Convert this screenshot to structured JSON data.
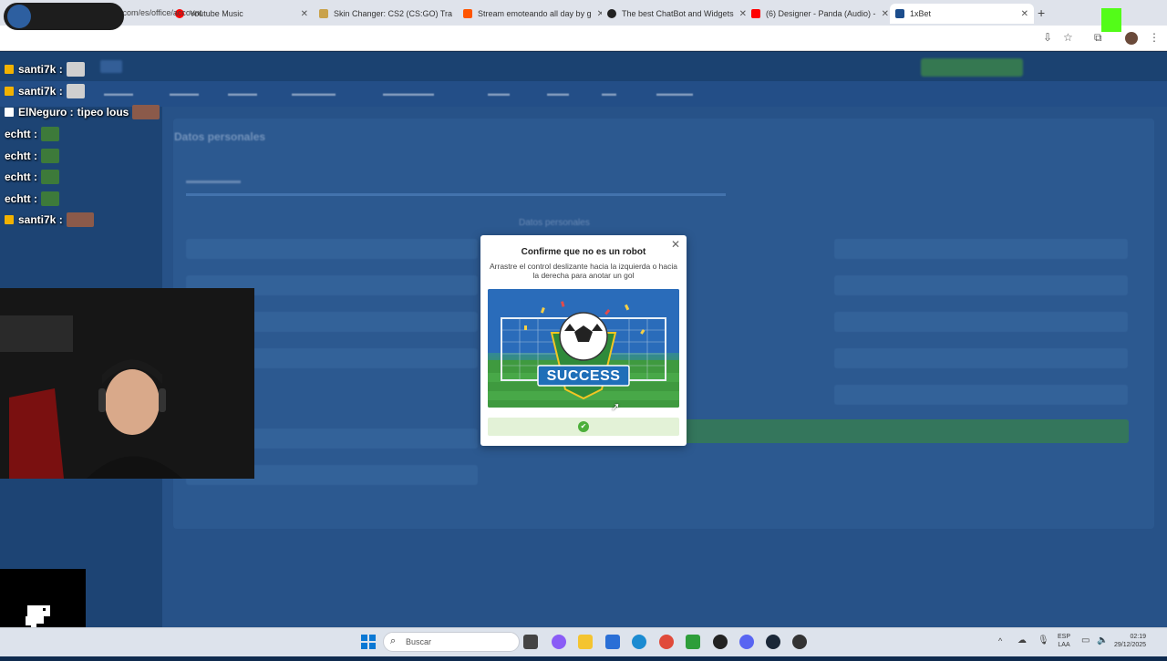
{
  "browser": {
    "tabs": [
      {
        "label": "Youtube Music",
        "icon": "youtube-music-icon"
      },
      {
        "label": "Skin Changer: CS2 (CS:GO) Tra",
        "icon": "skin-changer-icon"
      },
      {
        "label": "Stream emoteando all day by g",
        "icon": "soundcloud-icon"
      },
      {
        "label": "The best ChatBot and Widgets",
        "icon": "chatbot-icon"
      },
      {
        "label": "(6) Designer - Panda (Audio) -",
        "icon": "youtube-icon"
      },
      {
        "label": "1xBet",
        "icon": "onexbet-icon"
      }
    ],
    "url": "ar-xbet.com/es/office/account"
  },
  "site": {
    "title": "Datos personales",
    "section": "Datos personales"
  },
  "modal": {
    "title": "Confirme que no es un robot",
    "description": "Arrastre el control deslizante hacia la izquierda o hacia la derecha para anotar un gol",
    "image_text": "SUCCESS",
    "slider_state": "success"
  },
  "stream_overlay": {
    "chat": [
      {
        "user": "santi7k :",
        "message": "",
        "badge_color": "#f2b200"
      },
      {
        "user": "santi7k :",
        "message": "",
        "badge_color": "#f2b200"
      },
      {
        "user": "ElNeguro :",
        "message": "tipeo lous",
        "badge_color": "#ffffff"
      },
      {
        "user": "echtt :",
        "message": "",
        "badge_color": ""
      },
      {
        "user": "echtt :",
        "message": "",
        "badge_color": ""
      },
      {
        "user": "echtt :",
        "message": "",
        "badge_color": ""
      },
      {
        "user": "echtt :",
        "message": "",
        "badge_color": ""
      },
      {
        "user": "santi7k :",
        "message": "",
        "badge_color": "#f2b200"
      }
    ]
  },
  "taskbar": {
    "search_placeholder": "Buscar",
    "lang": "ESP",
    "region": "LAA",
    "time": "02:19",
    "date": "29/12/2025"
  },
  "colors": {
    "accent_green": "#4caf3a",
    "site_blue": "#1f4a7d"
  }
}
